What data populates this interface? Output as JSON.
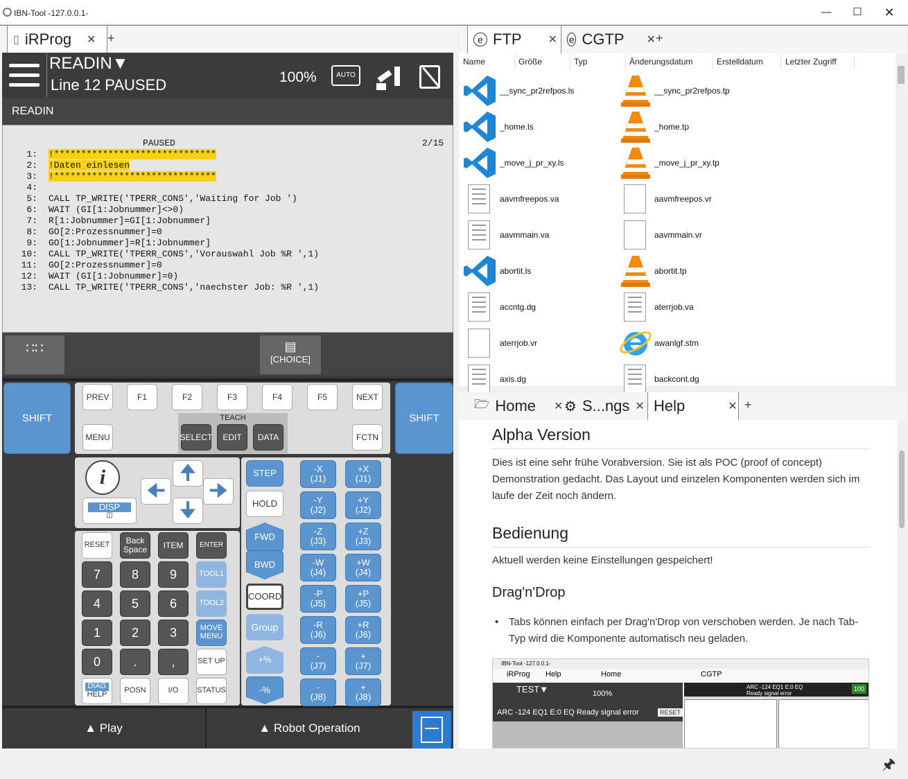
{
  "window": {
    "title": "IBN-Tool -127.0.0.1-"
  },
  "left_tabs": {
    "prog": "iRProg",
    "add": "+"
  },
  "pendant": {
    "header": {
      "program": "READIN▼",
      "status": "Line 12 PAUSED",
      "override": "100%",
      "auto": "AUTO"
    },
    "screen_title": "READIN",
    "paused": "PAUSED",
    "position": "2/15",
    "lines": [
      {
        "n": "1:",
        "t": "!******************************"
      },
      {
        "n": "2:",
        "t": "!Daten einlesen"
      },
      {
        "n": "3:",
        "t": "!******************************"
      },
      {
        "n": "4:",
        "t": ""
      },
      {
        "n": "5:",
        "t": "CALL TP_WRITE('TPERR_CONS','Waiting for Job ')"
      },
      {
        "n": "6:",
        "t": "WAIT (GI[1:Jobnummer]<>0)"
      },
      {
        "n": "7:",
        "t": "R[1:Jobnummer]=GI[1:Jobnummer]"
      },
      {
        "n": "8:",
        "t": "GO[2:Prozessnummer]=0"
      },
      {
        "n": "9:",
        "t": "GO[1:Jobnummer]=R[1:Jobnummer]"
      },
      {
        "n": "10:",
        "t": "CALL TP_WRITE('TPERR_CONS','Vorauswahl Job %R ',1)"
      },
      {
        "n": "11:",
        "t": "GO[2:Prozessnummer]=0"
      },
      {
        "n": "12:",
        "t": "WAIT (GI[1:Jobnummer]=0)"
      },
      {
        "n": "13:",
        "t": "CALL TP_WRITE('TPERR_CONS','naechster Job: %R ',1)"
      }
    ],
    "choice": "[CHOICE]",
    "keys": {
      "shift": "SHIFT",
      "prev": "PREV",
      "f1": "F1",
      "f2": "F2",
      "f3": "F3",
      "f4": "F4",
      "f5": "F5",
      "next": "NEXT",
      "menu": "MENU",
      "teach": "TEACH",
      "select": "SELECT",
      "edit": "EDIT",
      "data": "DATA",
      "fctn": "FCTN",
      "disp": "DISP",
      "step": "STEP",
      "hold": "HOLD",
      "fwd": "FWD",
      "bwd": "BWD",
      "coord": "COORD",
      "group": "Group",
      "pplus": "+%",
      "pminus": "-%",
      "reset": "RESET",
      "back": "Back Space",
      "item": "ITEM",
      "enter": "ENTER",
      "tool1": "TOOL1",
      "tool2": "TOOL2",
      "move": "MOVE MENU",
      "setup": "SET UP",
      "diag": "DIAG",
      "help": "HELP",
      "posn": "POSN",
      "io": "I/O",
      "status": "STATUS",
      "n7": "7",
      "n8": "8",
      "n9": "9",
      "n4": "4",
      "n5": "5",
      "n6": "6",
      "n1": "1",
      "n2": "2",
      "n3": "3",
      "n0": "0",
      "dot": ".",
      "comma": ",",
      "jog": [
        [
          "-X",
          "(J1)",
          "+X",
          "(J1)"
        ],
        [
          "-Y",
          "(J2)",
          "+Y",
          "(J2)"
        ],
        [
          "-Z",
          "(J3)",
          "+Z",
          "(J3)"
        ],
        [
          "-W",
          "(J4)",
          "+W",
          "(J4)"
        ],
        [
          "-P",
          "(J5)",
          "+P",
          "(J5)"
        ],
        [
          "-R",
          "(J6)",
          "+R",
          "(J6)"
        ],
        [
          "-",
          "(J7)",
          "+",
          "(J7)"
        ],
        [
          "-",
          "(J8)",
          "+",
          "(J8)"
        ]
      ]
    },
    "bottom": {
      "play": "▲ Play",
      "robot": "▲ Robot Operation"
    }
  },
  "ftp": {
    "tabs": [
      "FTP",
      "CGTP"
    ],
    "columns": [
      "Name",
      "Größe",
      "Typ",
      "Änderungsdatum",
      "Erstelldatum",
      "Letzter Zugriff"
    ],
    "rows": [
      {
        "a": "__sync_pr2refpos.ls",
        "ai": "vscode",
        "b": "__sync_pr2refpos.tp",
        "bi": "vlc"
      },
      {
        "a": "_home.ls",
        "ai": "vscode",
        "b": "_home.tp",
        "bi": "vlc"
      },
      {
        "a": "_move_j_pr_xy.ls",
        "ai": "vscode",
        "b": "_move_j_pr_xy.tp",
        "bi": "vlc"
      },
      {
        "a": "aavmfreepos.va",
        "ai": "doc",
        "b": "aavmfreepos.vr",
        "bi": "blank"
      },
      {
        "a": "aavmmain.va",
        "ai": "doc",
        "b": "aavmmain.vr",
        "bi": "blank"
      },
      {
        "a": "abortit.ls",
        "ai": "vscode",
        "b": "abortit.tp",
        "bi": "vlc"
      },
      {
        "a": "accntg.dg",
        "ai": "doc",
        "b": "aterrjob.va",
        "bi": "doc"
      },
      {
        "a": "aterrjob.vr",
        "ai": "blank",
        "b": "awanlgf.stm",
        "bi": "ie"
      },
      {
        "a": "axis.dg",
        "ai": "doc",
        "b": "backcont.dg",
        "bi": "doc"
      }
    ]
  },
  "help": {
    "tabs": [
      "Home",
      "S...ngs",
      "Help"
    ],
    "h1": "Alpha Version",
    "p1": "Dies ist eine sehr frühe Vorabversion. Sie ist als POC (proof of concept) Demonstration gedacht. Das Layout und einzelen Komponenten werden sich im laufe der Zeit noch ändern.",
    "h2": "Bedienung",
    "p2": "Aktuell werden keine Einstellungen gespeichert!",
    "h3": "Drag'n'Drop",
    "li": "Tabs können einfach per Drag'n'Drop von verschoben werden. Je nach Tab-Typ wird die Komponente automatisch neu geladen.",
    "shot": {
      "title": "IBN-Tool -127.0.0.1-",
      "tabs": [
        "iRProg",
        "Help",
        "Home",
        "CGTP"
      ],
      "test": "TEST▼",
      "pct": "100%",
      "err": "ARC -124 EQ1 E:0 EQ Ready signal error",
      "err2": "ARC -124 EQ1 E:0 EQ Ready signal error",
      "reset": "RESET",
      "hundred": "100"
    }
  }
}
